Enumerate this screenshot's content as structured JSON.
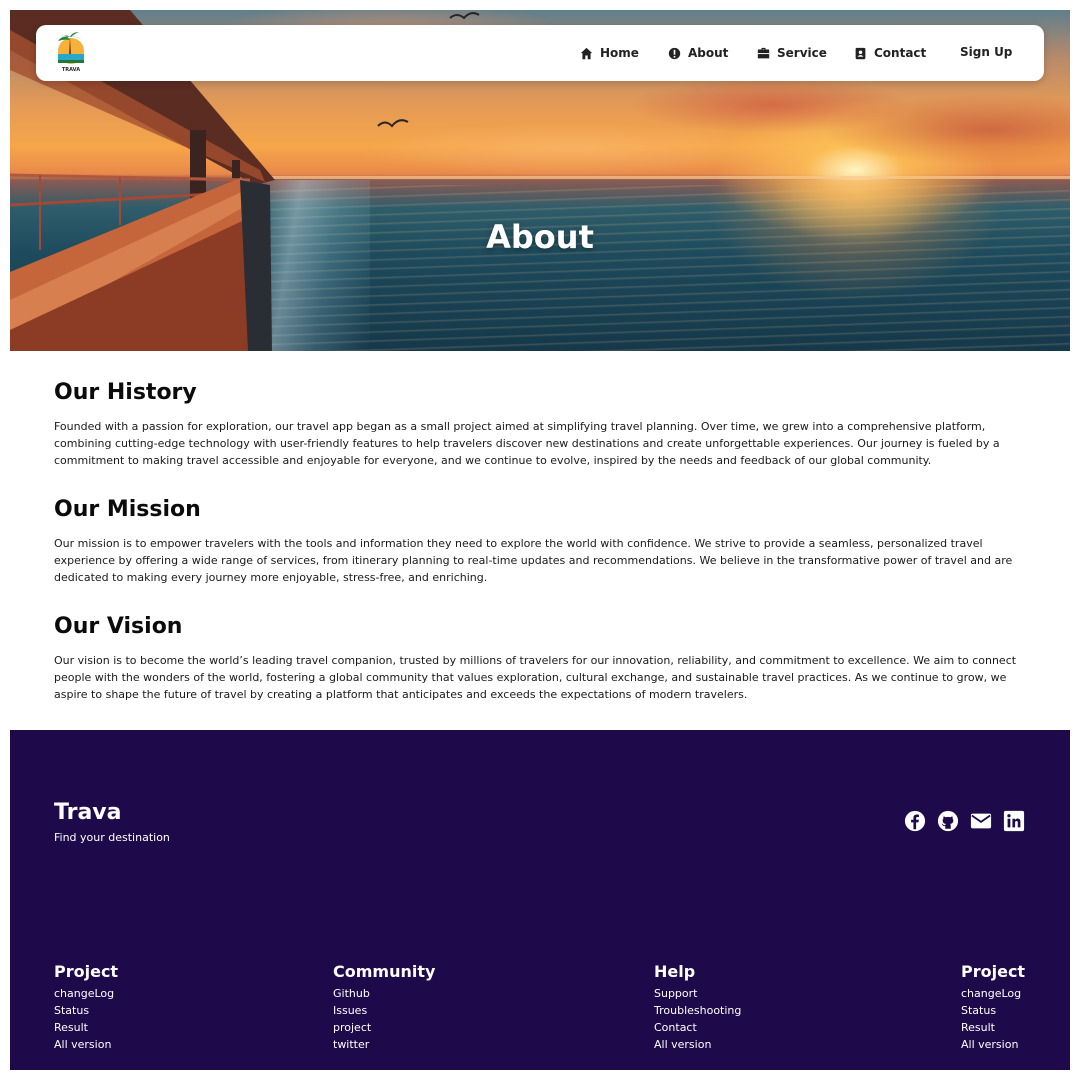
{
  "nav": {
    "items": [
      {
        "label": "Home",
        "icon": "home-icon"
      },
      {
        "label": "About",
        "icon": "info-icon"
      },
      {
        "label": "Service",
        "icon": "briefcase-icon"
      },
      {
        "label": "Contact",
        "icon": "contact-icon"
      }
    ],
    "signup": "Sign Up",
    "logo_text": "TRAVA"
  },
  "hero": {
    "title": "About"
  },
  "sections": [
    {
      "title": "Our History",
      "body": "Founded with a passion for exploration, our travel app began as a small project aimed at simplifying travel planning. Over time, we grew into a comprehensive platform, combining cutting-edge technology with user-friendly features to help travelers discover new destinations and create unforgettable experiences. Our journey is fueled by a commitment to making travel accessible and enjoyable for everyone, and we continue to evolve, inspired by the needs and feedback of our global community."
    },
    {
      "title": "Our Mission",
      "body": "Our mission is to empower travelers with the tools and information they need to explore the world with confidence. We strive to provide a seamless, personalized travel experience by offering a wide range of services, from itinerary planning to real-time updates and recommendations. We believe in the transformative power of travel and are dedicated to making every journey more enjoyable, stress-free, and enriching."
    },
    {
      "title": "Our Vision",
      "body": "Our vision is to become the world’s leading travel companion, trusted by millions of travelers for our innovation, reliability, and commitment to excellence. We aim to connect people with the wonders of the world, fostering a global community that values exploration, cultural exchange, and sustainable travel practices. As we continue to grow, we aspire to shape the future of travel by creating a platform that anticipates and exceeds the expectations of modern travelers."
    }
  ],
  "footer": {
    "brand": "Trava",
    "tagline": "Find your destination",
    "socials": [
      "facebook-icon",
      "github-icon",
      "mail-icon",
      "linkedin-icon"
    ],
    "columns": [
      {
        "title": "Project",
        "links": [
          "changeLog",
          "Status",
          "Result",
          "All version"
        ]
      },
      {
        "title": "Community",
        "links": [
          "Github",
          "Issues",
          "project",
          "twitter"
        ]
      },
      {
        "title": "Help",
        "links": [
          "Support",
          "Troubleshooting",
          "Contact",
          "All version"
        ]
      },
      {
        "title": "Project",
        "links": [
          "changeLog",
          "Status",
          "Result",
          "All version"
        ]
      }
    ]
  },
  "colors": {
    "footer_bg": "#1e0a4a",
    "nav_bg": "#ffffff",
    "text": "#111111"
  }
}
